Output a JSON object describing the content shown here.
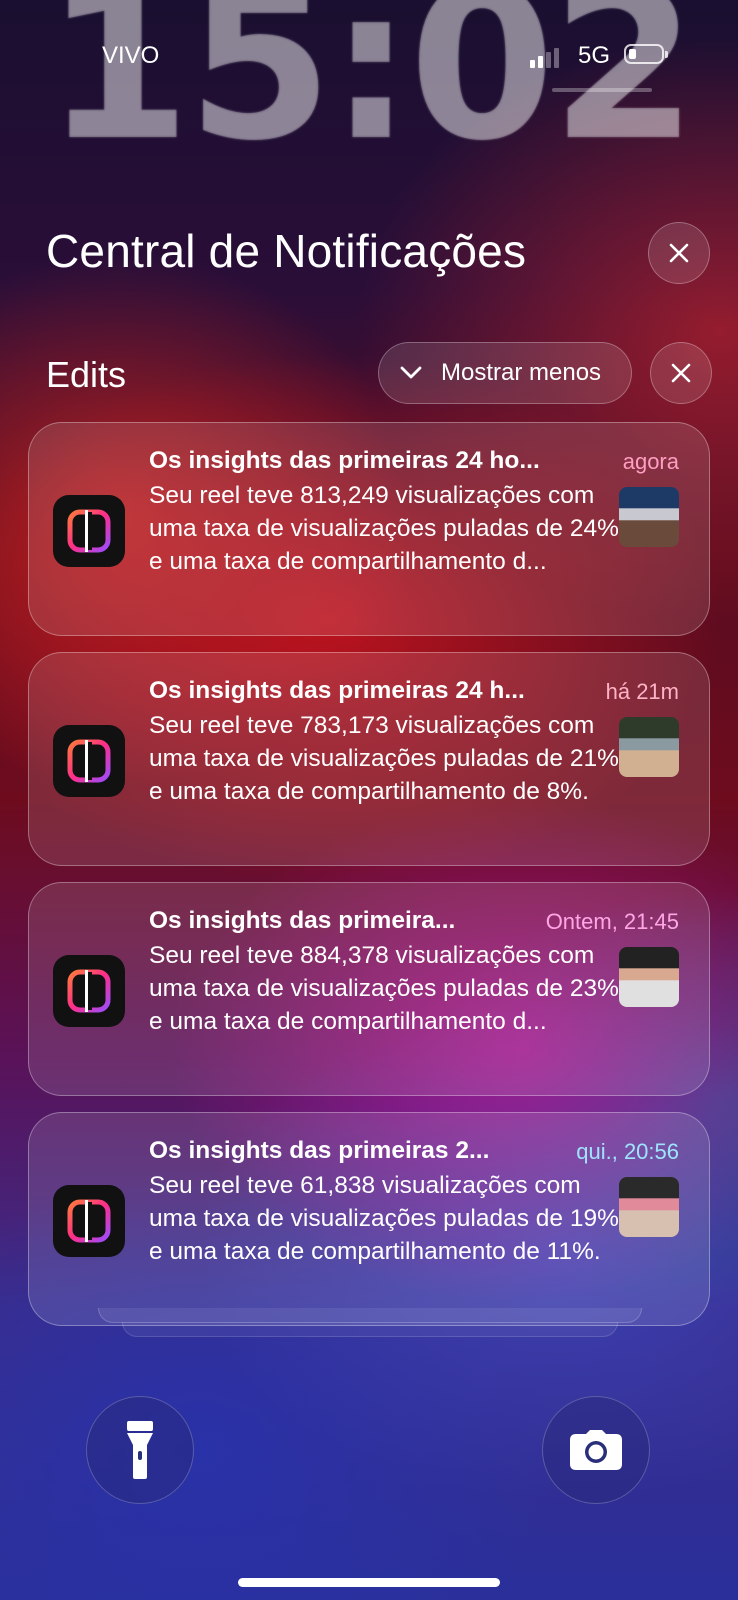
{
  "lockscreen": {
    "time": "15:02"
  },
  "status_bar": {
    "carrier": "VIVO",
    "network": "5G"
  },
  "header": {
    "title": "Central de Notificações"
  },
  "group": {
    "name": "Edits",
    "show_less_label": "Mostrar menos"
  },
  "notifications": [
    {
      "title": "Os insights das primeiras 24 ho...",
      "time": "agora",
      "time_color": "#ff9ec2",
      "body": "Seu reel teve 813,249 visualizações com uma taxa de visualizações puladas de 24% e uma taxa de compartilhamento d...",
      "thumb_colors": [
        "#1d3a66",
        "#c8c8d0",
        "#6a4a3a"
      ]
    },
    {
      "title": "Os insights das primeiras 24 h...",
      "time": "há 21m",
      "time_color": "#ffb2c8",
      "body": "Seu reel teve 783,173 visualizações com uma taxa de visualizações puladas de 21% e uma taxa de compartilhamento de 8%.",
      "thumb_colors": [
        "#2e3a2a",
        "#8a9aa0",
        "#d0b090"
      ]
    },
    {
      "title": "Os insights das primeira...",
      "time": "Ontem, 21:45",
      "time_color": "#ffa6e6",
      "body": "Seu reel teve 884,378 visualizações com uma taxa de visualizações puladas de 23% e uma taxa de compartilhamento d...",
      "thumb_colors": [
        "#222222",
        "#d8a890",
        "#e0e0e0"
      ]
    },
    {
      "title": "Os insights das primeiras 2...",
      "time": "qui., 20:56",
      "time_color": "#9fe4ff",
      "body": "Seu reel teve 61,838 visualizações com uma taxa de visualizações puladas de 19% e uma taxa de compartilhamento de 11%.",
      "thumb_colors": [
        "#2a2a2a",
        "#e08a9a",
        "#d8c0b0"
      ]
    }
  ],
  "dock": {
    "left_icon": "flashlight-icon",
    "right_icon": "camera-icon"
  }
}
